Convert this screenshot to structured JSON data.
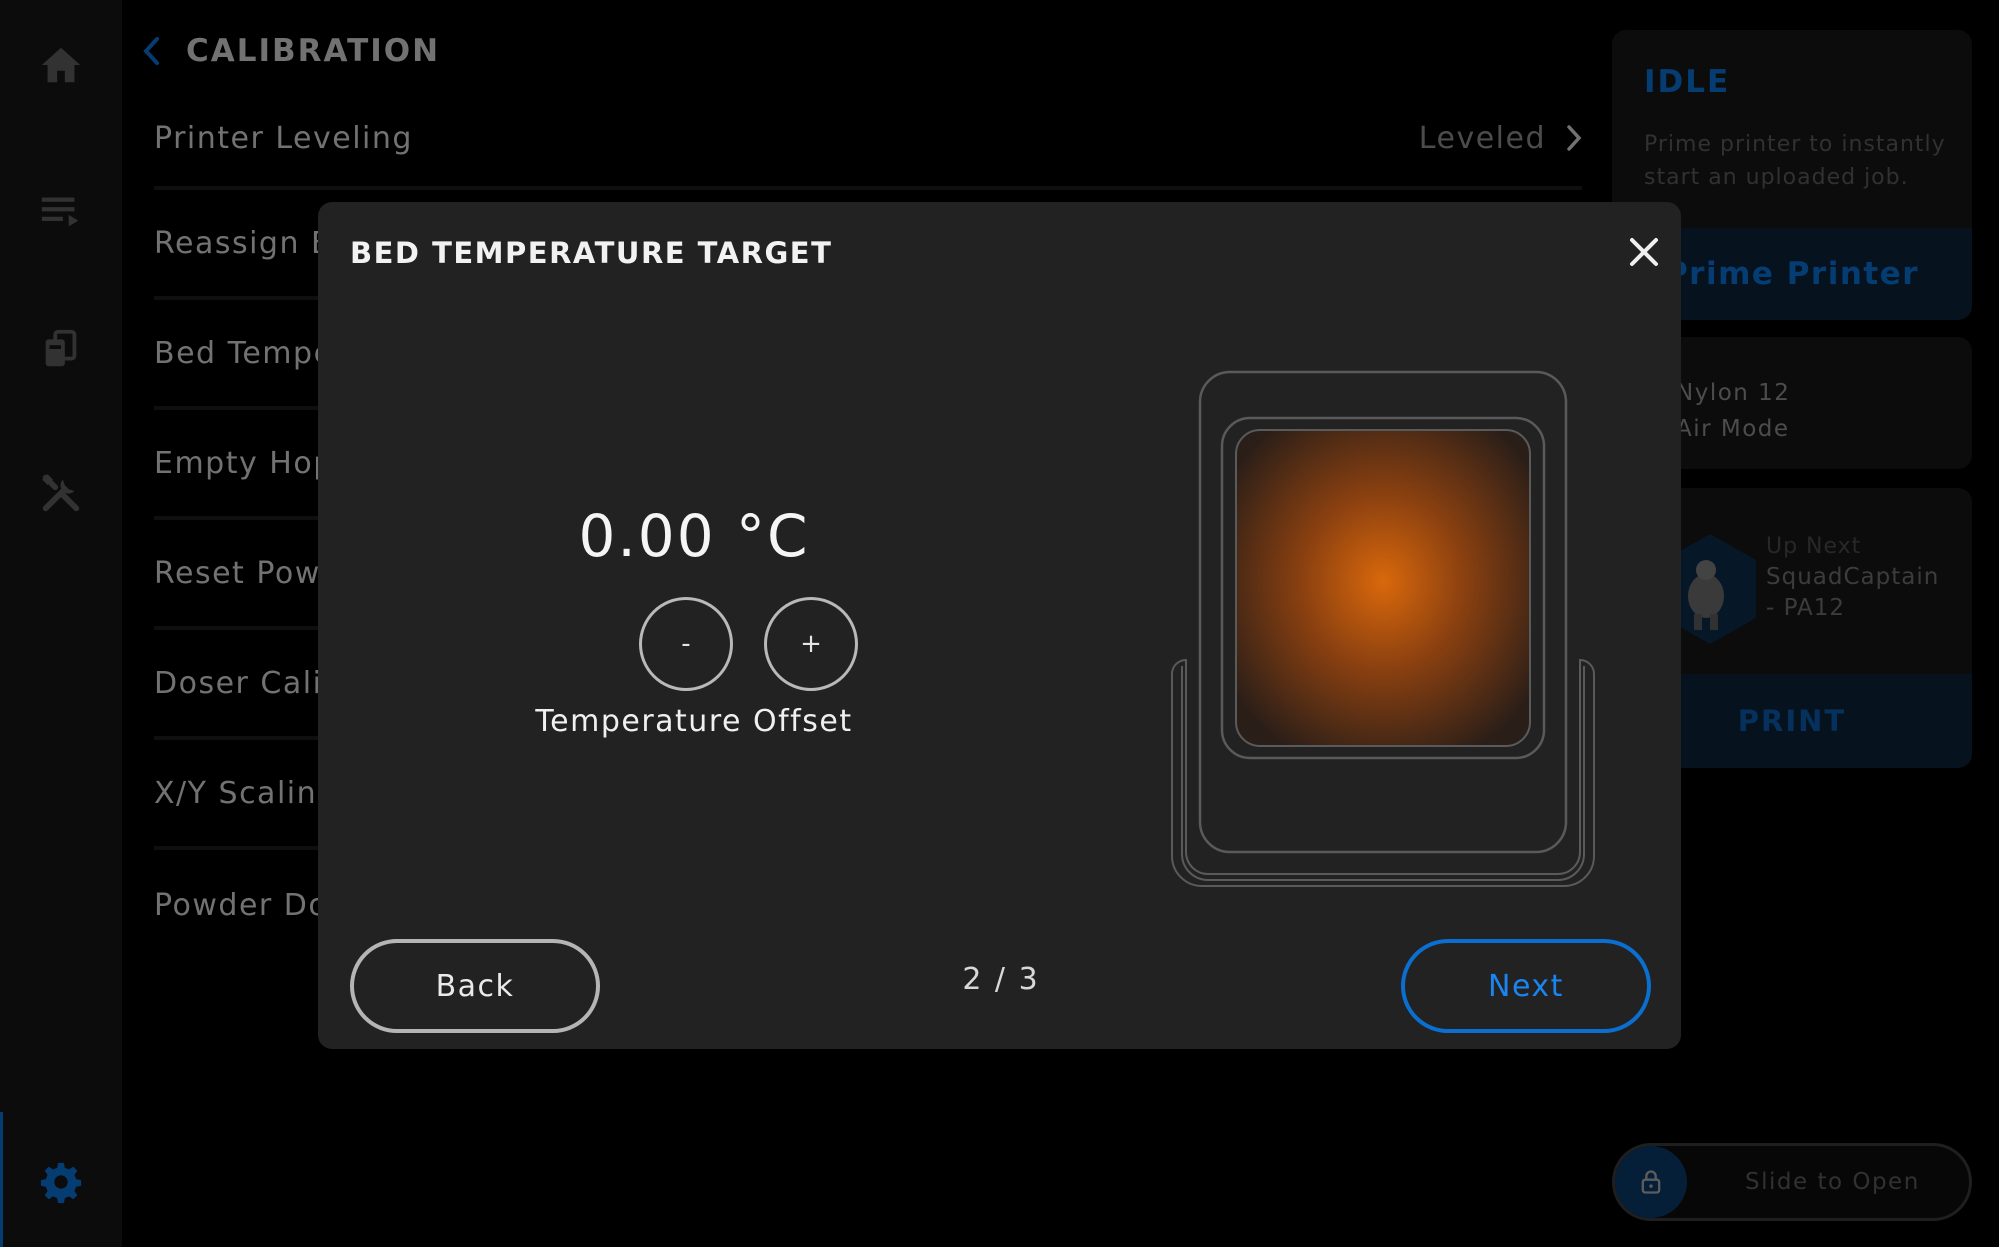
{
  "colors": {
    "accent": "#0a6fd0",
    "background": "#000000",
    "modal_background": "#222222",
    "bed_heat": "#e07010"
  },
  "sidebar": {
    "items": [
      {
        "icon": "home-icon"
      },
      {
        "icon": "queue-list-icon"
      },
      {
        "icon": "material-icon"
      },
      {
        "icon": "tools-icon"
      },
      {
        "icon": "gear-icon",
        "active": true
      }
    ]
  },
  "header": {
    "back_icon": "chevron-left-icon",
    "title": "CALIBRATION"
  },
  "list": {
    "items": [
      {
        "label": "Printer Leveling",
        "value": "Leveled"
      },
      {
        "label": "Reassign B"
      },
      {
        "label": "Bed Tempe"
      },
      {
        "label": "Empty Hop"
      },
      {
        "label": "Reset Pow"
      },
      {
        "label": "Doser Cali"
      },
      {
        "label": "X/Y Scalin"
      },
      {
        "label": "Powder Do"
      }
    ]
  },
  "status_panel": {
    "state": "IDLE",
    "description": "Prime printer to instantly start an uploaded job.",
    "prime_button": "Prime Printer",
    "material_line1": "Nylon 12",
    "material_line2": "Air Mode",
    "up_next_label": "Up Next",
    "up_next_name": "SquadCaptain - PA12",
    "print_button": "PRINT"
  },
  "slider": {
    "label": "Slide to Open",
    "icon": "lock-icon"
  },
  "modal": {
    "title": "BED TEMPERATURE TARGET",
    "close_icon": "close-icon",
    "temperature_value": "0.00 °C",
    "minus_label": "-",
    "plus_label": "+",
    "offset_label": "Temperature Offset",
    "back_button": "Back",
    "pager": "2 / 3",
    "next_button": "Next"
  }
}
